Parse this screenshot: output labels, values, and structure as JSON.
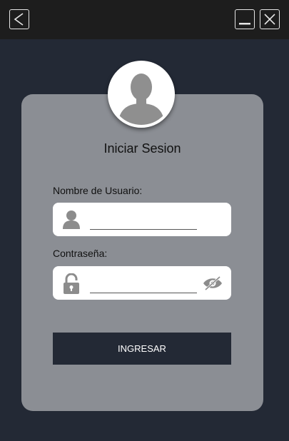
{
  "titlebar": {
    "back_icon": "chevron-left-icon",
    "minimize_icon": "minimize-icon",
    "close_icon": "close-icon"
  },
  "login": {
    "avatar_icon": "user-silhouette-icon",
    "title": "Iniciar Sesion",
    "username_label": "Nombre de Usuario:",
    "username_value": "",
    "username_icon": "user-icon",
    "password_label": "Contraseña:",
    "password_value": "",
    "password_icon": "lock-icon",
    "toggle_visibility_icon": "eye-slash-icon",
    "submit_label": "INGRESAR"
  },
  "colors": {
    "background": "#232935",
    "titlebar": "#1d1d1d",
    "card": "#8b8e94",
    "button": "#232935"
  }
}
